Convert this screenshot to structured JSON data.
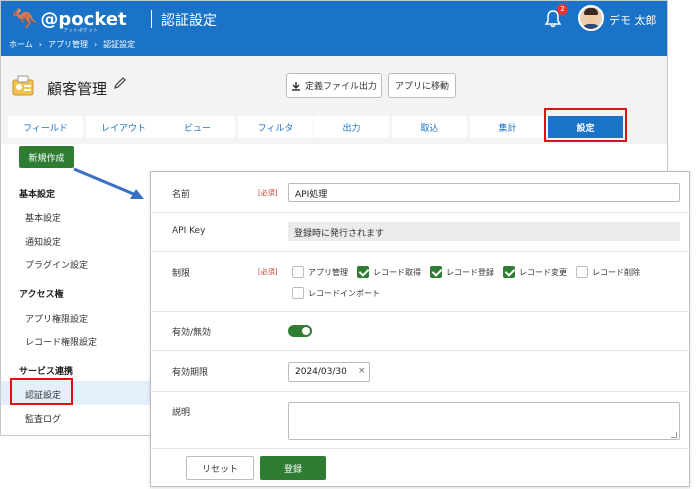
{
  "header": {
    "logo_text": "@pocket",
    "logo_sub": "アットポケット",
    "title": "認証設定",
    "breadcrumb": [
      "ホーム",
      "アプリ管理",
      "認証設定"
    ],
    "notification_count": "2",
    "user_name": "デモ 太郎"
  },
  "app": {
    "name": "顧客管理",
    "export_button": "定義ファイル出力",
    "move_button": "アプリに移動"
  },
  "tabs": [
    {
      "label": "フィールド"
    },
    {
      "label": "レイアウト"
    },
    {
      "label": "ビュー"
    },
    {
      "label": "フィルタ"
    },
    {
      "label": "出力"
    },
    {
      "label": "取込"
    },
    {
      "label": "集計"
    },
    {
      "label": "設定",
      "active": true
    }
  ],
  "new_button": "新規作成",
  "sidebar": {
    "sections": [
      {
        "title": "基本設定",
        "items": [
          "基本設定",
          "通知設定",
          "プラグイン設定"
        ]
      },
      {
        "title": "アクセス権",
        "items": [
          "アプリ権限設定",
          "レコード権限設定"
        ]
      },
      {
        "title": "サービス連携",
        "items": [
          "認証設定",
          "監査ログ"
        ]
      }
    ],
    "active_item": "認証設定"
  },
  "form": {
    "required_label": "[必須]",
    "name": {
      "label": "名前",
      "value": "API処理"
    },
    "api_key": {
      "label": "API Key",
      "value": "登録時に発行されます"
    },
    "permissions": {
      "label": "制限",
      "options": [
        {
          "label": "アプリ管理",
          "checked": false
        },
        {
          "label": "レコード取得",
          "checked": true
        },
        {
          "label": "レコード登録",
          "checked": true
        },
        {
          "label": "レコード変更",
          "checked": true
        },
        {
          "label": "レコード削除",
          "checked": false
        },
        {
          "label": "レコードインポート",
          "checked": false
        }
      ]
    },
    "enabled": {
      "label": "有効/無効",
      "value": true
    },
    "expiry": {
      "label": "有効期限",
      "value": "2024/03/30",
      "clear": "×"
    },
    "description": {
      "label": "説明",
      "value": ""
    },
    "reset_button": "リセット",
    "save_button": "登録"
  },
  "colors": {
    "header_blue": "#1a73c6",
    "accent_green": "#2f7d33",
    "highlight_red": "#e01010"
  }
}
